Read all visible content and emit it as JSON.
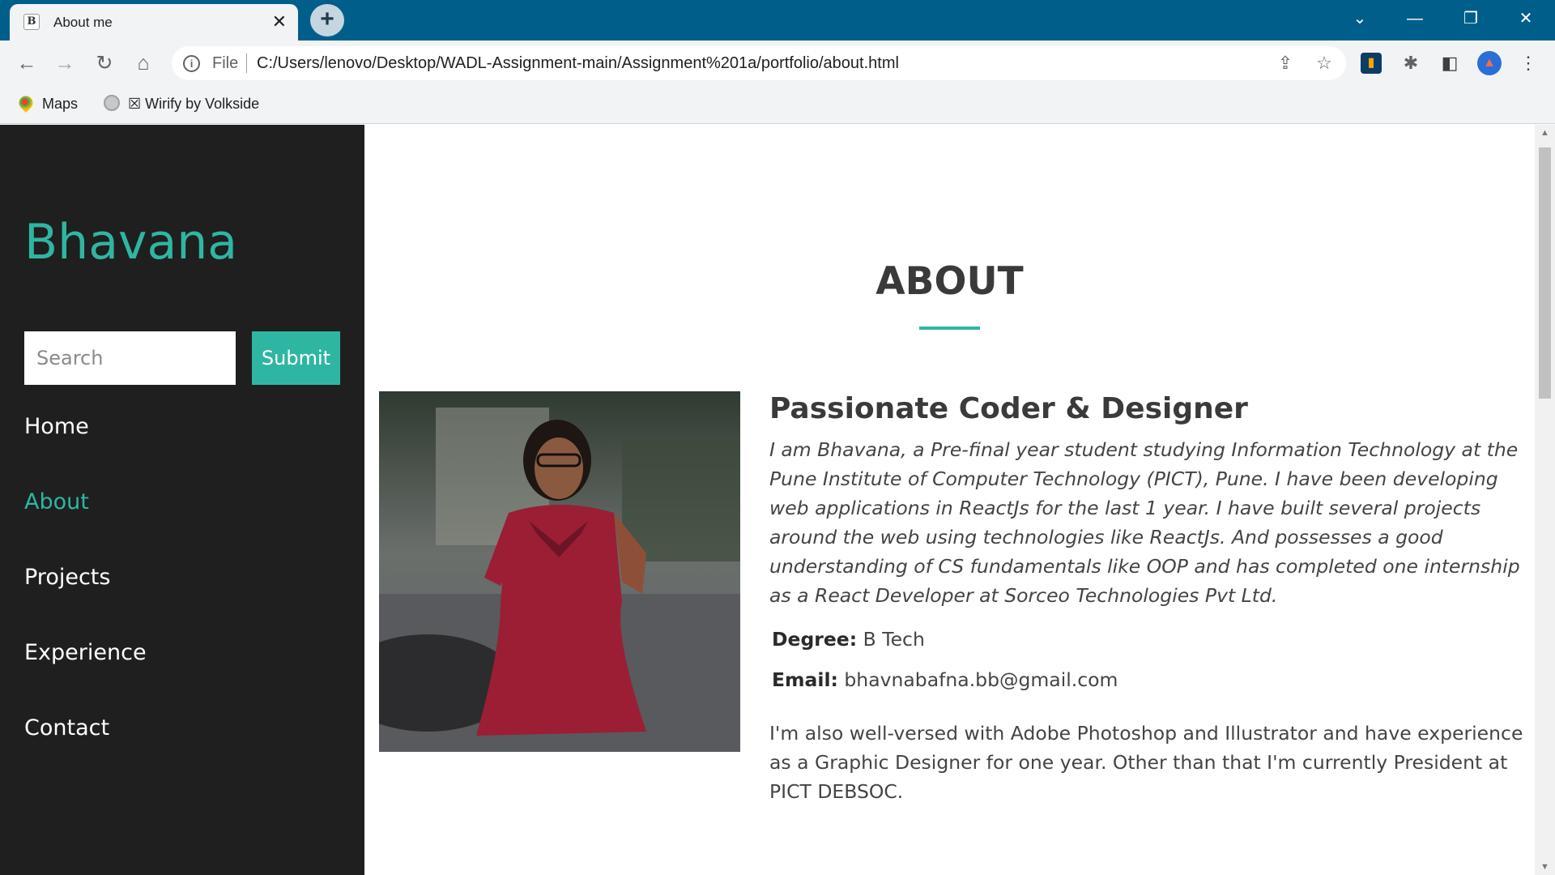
{
  "browser": {
    "tab_title": "About me",
    "tab_favicon": "B",
    "url_scheme": "File",
    "url": "C:/Users/lenovo/Desktop/WADL-Assignment-main/Assignment%201a/portfolio/about.html",
    "bookmarks": [
      {
        "label": "Maps"
      },
      {
        "label": "☒ Wirify by Volkside"
      }
    ]
  },
  "sidebar": {
    "brand": "Bhavana",
    "search_placeholder": "Search",
    "submit_label": "Submit",
    "nav": [
      {
        "label": "Home"
      },
      {
        "label": "About"
      },
      {
        "label": "Projects"
      },
      {
        "label": "Experience"
      },
      {
        "label": "Contact"
      }
    ],
    "active_index": 1
  },
  "main": {
    "title": "ABOUT",
    "heading": "Passionate Coder & Designer",
    "bio": "I am Bhavana, a Pre-final year student studying Information Technology at the Pune Institute of Computer Technology (PICT), Pune. I have been developing web applications in ReactJs for the last 1 year. I have built several projects around the web using technologies like ReactJs. And possesses a good understanding of CS fundamentals like OOP and has completed one internship as a React Developer at Sorceo Technologies Pvt Ltd.",
    "degree_label": "Degree:",
    "degree_value": "B Tech",
    "email_label": "Email:",
    "email_value": "bhavnabafna.bb@gmail.com",
    "extra": "I'm also well-versed with Adobe Photoshop and Illustrator and have experience as a Graphic Designer for one year. Other than that I'm currently President at PICT DEBSOC."
  },
  "colors": {
    "accent": "#2fb6a3",
    "sidebar_bg": "#1f1f1f",
    "chrome_tabbar": "#005f8a"
  }
}
